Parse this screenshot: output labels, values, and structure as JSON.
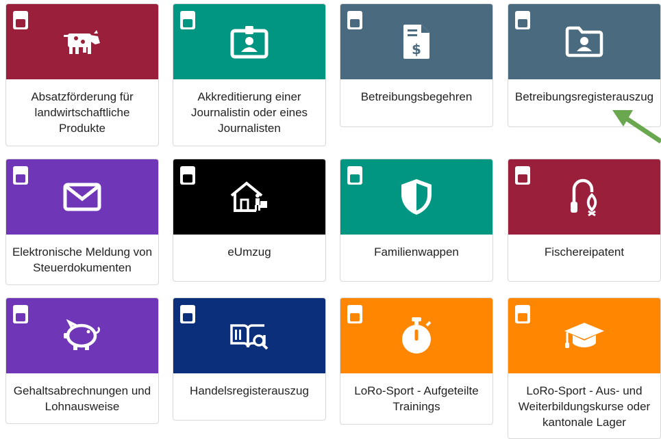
{
  "cards": [
    {
      "label": "Absatzförderung für landwirtschaftliche Produkte",
      "color": "#9a1f3a",
      "icon": "cow-icon"
    },
    {
      "label": "Akkreditierung einer Journalistin oder eines Journalisten",
      "color": "#009681",
      "icon": "id-badge-icon"
    },
    {
      "label": "Betreibungsbegehren",
      "color": "#4a6a80",
      "icon": "invoice-dollar-icon"
    },
    {
      "label": "Betreibungsregisterauszug",
      "color": "#4a6a80",
      "icon": "folder-user-icon"
    },
    {
      "label": "Elektronische Meldung von Steuerdokumenten",
      "color": "#6f37b8",
      "icon": "envelope-icon"
    },
    {
      "label": "eUmzug",
      "color": "#000000",
      "icon": "house-move-icon"
    },
    {
      "label": "Familienwappen",
      "color": "#009681",
      "icon": "shield-icon"
    },
    {
      "label": "Fischereipatent",
      "color": "#9a1f3a",
      "icon": "fishing-hook-icon"
    },
    {
      "label": "Gehaltsabrechnungen und Lohnausweise",
      "color": "#6f37b8",
      "icon": "piggy-bank-icon"
    },
    {
      "label": "Handelsregisterauszug",
      "color": "#0b2f7a",
      "icon": "book-search-icon"
    },
    {
      "label": "LoRo-Sport - Aufgeteilte Trainings",
      "color": "#ff8600",
      "icon": "stopwatch-icon"
    },
    {
      "label": "LoRo-Sport - Aus- und Weiterbildungskurse oder kantonale Lager",
      "color": "#ff8600",
      "icon": "graduation-cap-icon"
    }
  ],
  "annotation": {
    "arrow_color": "#6aa84f",
    "icon": "arrow-pointer-icon"
  }
}
